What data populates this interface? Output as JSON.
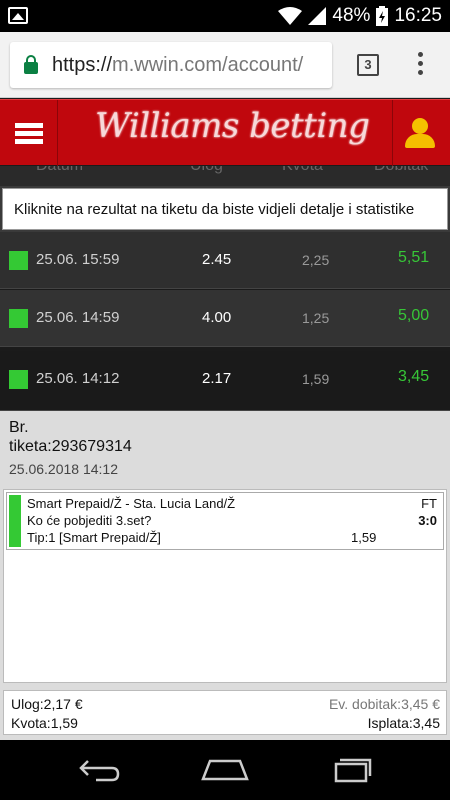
{
  "status_bar": {
    "battery": "48%",
    "time": "16:25"
  },
  "browser": {
    "url_scheme": "https://",
    "url_rest": "m.wwin.com/account/",
    "tab_count": "3"
  },
  "app": {
    "logo": "Williams betting"
  },
  "table": {
    "headers": [
      "Datum",
      "Ulog",
      "Kvota",
      "Dobitak"
    ],
    "info": "Kliknite na rezultat na tiketu da biste vidjeli detalje i statistike",
    "rows": [
      {
        "date": "25.06. 15:59",
        "stake": "2.45",
        "odds": "2,25",
        "win": "5,51"
      },
      {
        "date": "25.06. 14:59",
        "stake": "4.00",
        "odds": "1,25",
        "win": "5,00"
      },
      {
        "date": "25.06. 14:12",
        "stake": "2.17",
        "odds": "1,59",
        "win": "3,45"
      }
    ]
  },
  "ticket": {
    "br_label": "Br.",
    "ticket_number": "tiketa:293679314",
    "date": "25.06.2018 14:12",
    "match": {
      "teams": "Smart Prepaid/Ž - Sta. Lucia Land/Ž",
      "question": "Ko će pobjediti 3.set?",
      "tip": "Tip:1 [Smart Prepaid/Ž]",
      "odds": "1,59",
      "status": "FT",
      "score": "3:0"
    },
    "summary": {
      "stake": "Ulog:2,17 €",
      "odds": "Kvota:1,59",
      "potential_win": "Ev. dobitak:3,45 €",
      "payout": "Isplata:3,45"
    }
  },
  "colors": {
    "brand_red": "#c0070d",
    "win_green": "#37c637",
    "user_yellow": "#f5c000"
  }
}
